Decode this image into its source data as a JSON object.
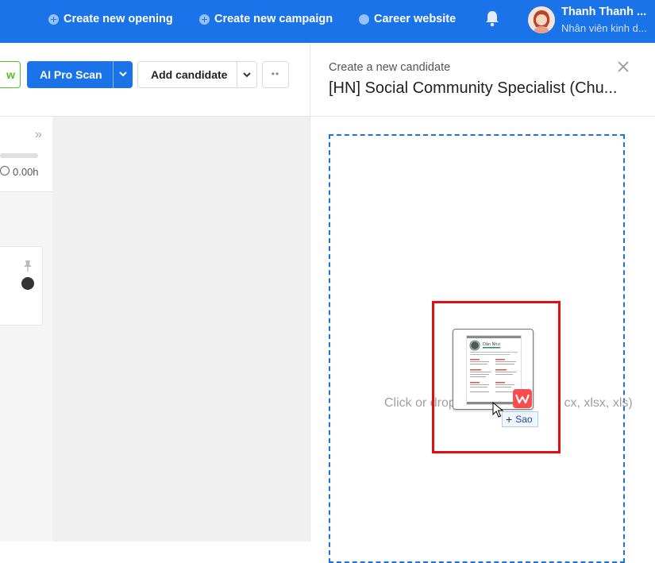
{
  "header": {
    "nav": [
      {
        "label": "Create new opening",
        "icon": "plus-circle-icon"
      },
      {
        "label": "Create new campaign",
        "icon": "plus-circle-icon"
      },
      {
        "label": "Career website",
        "icon": "globe-icon"
      }
    ],
    "user": {
      "name": "Thanh Thanh ...",
      "role": "Nhân viên kinh d..."
    },
    "brand_color": "#1a73e8"
  },
  "toolbar": {
    "partial_button_label": "w",
    "ai_scan_label": "AI Pro Scan",
    "add_candidate_label": "Add candidate",
    "more_label": "••"
  },
  "pipeline": {
    "time_label": "0.00h"
  },
  "panel": {
    "subtitle": "Create a new candidate",
    "title": "[HN] Social Community Specialist (Chu...",
    "drop_text": "Click or drop CV (.pdf, .docx, xlsx, xls)",
    "drop_text_visible_part": "Click or drop CV",
    "drop_text_tail": "cx, xlsx, xls)"
  },
  "drag": {
    "doc_heading": "Dần Như",
    "copy_label": "Sao",
    "highlight_color": "#e01010"
  }
}
